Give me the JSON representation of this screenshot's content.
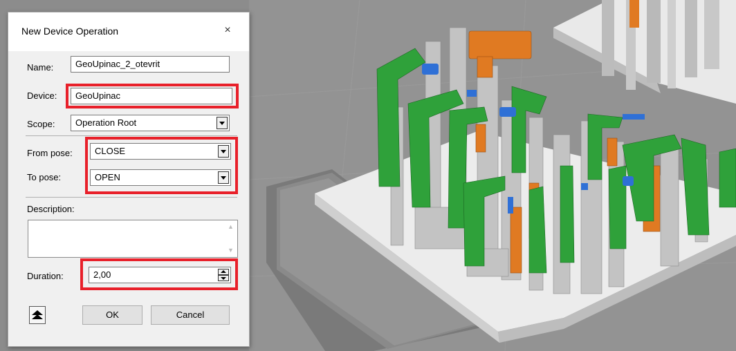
{
  "dialog": {
    "title": "New Device Operation",
    "close_glyph": "×",
    "name": {
      "label": "Name:",
      "value": "GeoUpinac_2_otevrit"
    },
    "device": {
      "label": "Device:",
      "value": "GeoUpinac"
    },
    "scope": {
      "label": "Scope:",
      "value": "Operation Root"
    },
    "from_pose": {
      "label": "From pose:",
      "value": "CLOSE"
    },
    "to_pose": {
      "label": "To pose:",
      "value": "OPEN"
    },
    "description": {
      "label": "Description:",
      "value": ""
    },
    "duration": {
      "label": "Duration:",
      "value": "2,00"
    },
    "ok_label": "OK",
    "cancel_label": "Cancel"
  },
  "icons": {
    "close": "close-icon",
    "dropdown": "chevron-down-icon",
    "spin": "spin-up-down-icon",
    "expand": "collapse-up-icon"
  },
  "colors": {
    "highlight": "#e8202a",
    "clamp_green": "#2fa13a",
    "clamp_orange": "#e07a22",
    "clamp_blue": "#2f70d6",
    "fixture_gray": "#c4c4c4",
    "background": "#8f8f8f"
  }
}
